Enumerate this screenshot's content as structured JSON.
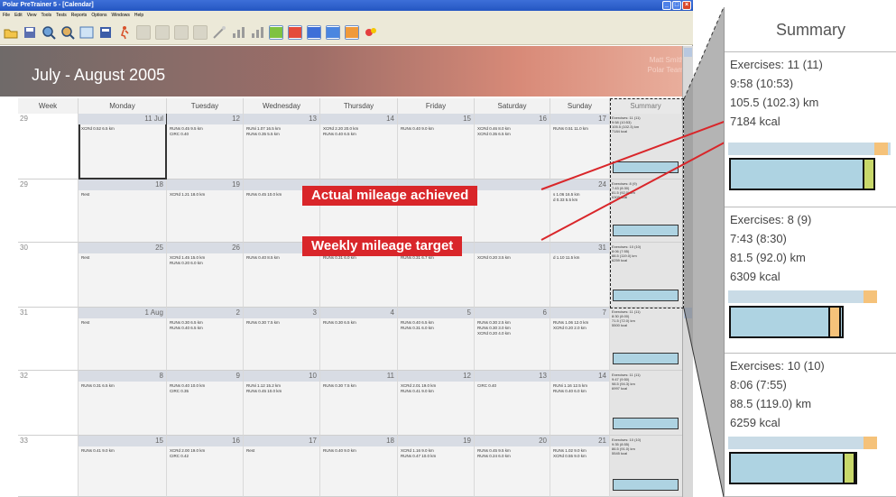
{
  "window": {
    "title": "Polar PreTrainer 5 - [Calendar]"
  },
  "menu": [
    "File",
    "Edit",
    "View",
    "Tools",
    "Tests",
    "Reports",
    "Options",
    "Windows",
    "Help"
  ],
  "toolbar_icons": [
    "open-icon",
    "save-icon",
    "search-icon",
    "search-alt-icon",
    "calendar-icon",
    "notes-icon",
    "runner-icon",
    "graph-dim-1",
    "graph-dim-2",
    "graph-dim-3",
    "graph-dim-4",
    "wand-icon",
    "chart-1",
    "chart-2",
    "chart-3",
    "chart-4",
    "chart-5",
    "chart-6",
    "test-icon"
  ],
  "banner": {
    "title": "July - August 2005",
    "user_name": "Matt Smith",
    "team": "Polar Team"
  },
  "columns": [
    "Week",
    "Monday",
    "Tuesday",
    "Wednesday",
    "Thursday",
    "Friday",
    "Saturday",
    "Sunday",
    "Summary"
  ],
  "weeks": [
    {
      "week": "29",
      "days": [
        {
          "num": "11 Jul",
          "ex": [
            "XCRd 0.52 6.5 km"
          ]
        },
        {
          "num": "12",
          "ex": [
            "RUNs 0.45 9.5 km",
            "CIRC 0.40"
          ]
        },
        {
          "num": "13",
          "ex": [
            "RUNi 1.07 16.5 km",
            "RUNs 0.35 5.5 km"
          ]
        },
        {
          "num": "14",
          "ex": [
            "XCRd 2.20 20.0 km",
            "RUNs 0.40 6.5 km"
          ]
        },
        {
          "num": "15",
          "ex": [
            "RUNs 0.40 9.0 km"
          ]
        },
        {
          "num": "16",
          "ex": [
            "XCRd 0.46 8.0 km",
            "XCRd 0.35 6.5 km"
          ]
        },
        {
          "num": "17",
          "ex": [
            "RUNs 0.51 11.0 km"
          ]
        }
      ],
      "summary": [
        "Exercises: 11 (11)",
        "9:58 (10:53)",
        "105.5 (102.3) km",
        "7184 kcal"
      ]
    },
    {
      "week": "29",
      "days": [
        {
          "num": "18",
          "ex": [
            "Rest"
          ]
        },
        {
          "num": "19",
          "ex": [
            "XCRd 1.21 18.0 km"
          ]
        },
        {
          "num": "",
          "ex": [
            "RUNs 0.45 10.0 km"
          ]
        },
        {
          "num": "",
          "ex": [
            ""
          ]
        },
        {
          "num": "",
          "ex": [
            ""
          ]
        },
        {
          "num": "",
          "ex": [
            ""
          ]
        },
        {
          "num": "24",
          "ex": [
            "s 1.06 16.5 km",
            "d 0.33 5.5 km"
          ]
        }
      ],
      "summary": [
        "Exercises: 8 (9)",
        "7:43 (8:30)",
        "81.5 (92.0) km",
        "6309 kcal"
      ]
    },
    {
      "week": "30",
      "days": [
        {
          "num": "25",
          "ex": [
            "Rest"
          ]
        },
        {
          "num": "26",
          "ex": [
            "XCRd 1.45 15.0 km",
            "RUNs 0.20 6.0 km"
          ]
        },
        {
          "num": "",
          "ex": [
            "RUNs 0.40 8.5 km"
          ]
        },
        {
          "num": "",
          "ex": [
            "RUNs 0.31 6.0 km"
          ]
        },
        {
          "num": "",
          "ex": [
            "RUNs 0.31 6.7 km"
          ]
        },
        {
          "num": "",
          "ex": [
            "XCRd 0.20 3.5 km"
          ]
        },
        {
          "num": "31",
          "ex": [
            "d 1.10 11.5 km"
          ]
        }
      ],
      "summary": [
        "Exercises: 10 (10)",
        "8:06 (7:55)",
        "88.5 (119.0) km",
        "6259 kcal"
      ]
    },
    {
      "week": "31",
      "days": [
        {
          "num": "1 Aug",
          "ex": [
            "Rest"
          ]
        },
        {
          "num": "2",
          "ex": [
            "RUNs 0.30 6.5 km",
            "RUNs 0.40 6.5 km"
          ]
        },
        {
          "num": "3",
          "ex": [
            "RUNs 0.30 7.5 km"
          ]
        },
        {
          "num": "4",
          "ex": [
            "RUNs 0.30 6.5 km"
          ]
        },
        {
          "num": "5",
          "ex": [
            "RUNs 0.40 6.5 km",
            "RUNs 0.31 6.0 km"
          ]
        },
        {
          "num": "6",
          "ex": [
            "RUNs 0.30 2.5 km",
            "RUNs 0.30 3.0 km",
            "XCRd 0.20 4.0 km"
          ]
        },
        {
          "num": "7",
          "ex": [
            "RUNs 1.06 12.0 km",
            "XCRd 0.20 2.0 km"
          ]
        }
      ],
      "summary": [
        "Exercises: 11 (11)",
        "8:30 (8:00)",
        "71.5 (72.0) km",
        "5500 kcal"
      ]
    },
    {
      "week": "32",
      "days": [
        {
          "num": "8",
          "ex": [
            "RUNs 0.31 6.5 km"
          ]
        },
        {
          "num": "9",
          "ex": [
            "RUNs 0.40 10.0 km",
            "CIRC 0.35"
          ]
        },
        {
          "num": "10",
          "ex": [
            "RUNi 1.12 15.2 km",
            "RUNs 0.45 10.0 km"
          ]
        },
        {
          "num": "11",
          "ex": [
            "RUNs 0.30 7.5 km"
          ]
        },
        {
          "num": "12",
          "ex": [
            "XCRd 2.01 19.0 km",
            "RUNs 0.41 9.0 km"
          ]
        },
        {
          "num": "13",
          "ex": [
            "CIRC 0.40"
          ]
        },
        {
          "num": "14",
          "ex": [
            "RUNi 1.16 12.5 km",
            "RUNs 0.40 6.0 km"
          ]
        }
      ],
      "summary": [
        "Exercises: 11 (11)",
        "9:47 (9:50)",
        "98.5 (94.3) km",
        "6997 kcal"
      ]
    },
    {
      "week": "33",
      "days": [
        {
          "num": "15",
          "ex": [
            "RUNs 0.41 9.0 km"
          ]
        },
        {
          "num": "16",
          "ex": [
            "XCRd 2.00 19.0 km",
            "CIRC 0.42"
          ]
        },
        {
          "num": "17",
          "ex": [
            "Rest"
          ]
        },
        {
          "num": "18",
          "ex": [
            "RUNs 0.40 9.0 km"
          ]
        },
        {
          "num": "19",
          "ex": [
            "XCRd 1.16 9.0 km",
            "RUNs 0.47 10.0 km"
          ]
        },
        {
          "num": "20",
          "ex": [
            "RUNs 0.45 9.5 km",
            "RUNs 0.24 6.0 km"
          ]
        },
        {
          "num": "21",
          "ex": [
            "RUNs 1.02 9.0 km",
            "XCRd 0.55 9.0 km"
          ]
        }
      ],
      "summary": [
        "Exercises: 10 (10)",
        "9:35 (8:55)",
        "86.5 (91.0) km",
        "5545 kcal"
      ]
    }
  ],
  "callouts": {
    "actual": "Actual mileage achieved",
    "target": "Weekly mileage target"
  },
  "zoom": {
    "title": "Summary",
    "sections": [
      {
        "lines": [
          "Exercises: 11 (11)",
          "9:58 (10:53)",
          "105.5 (102.3) km",
          "7184 kcal"
        ]
      },
      {
        "lines": [
          "Exercises: 8 (9)",
          "7:43 (8:30)",
          "81.5 (92.0) km",
          "6309 kcal"
        ]
      },
      {
        "lines": [
          "Exercises: 10 (10)",
          "8:06 (7:55)",
          "88.5 (119.0) km",
          "6259 kcal"
        ]
      }
    ]
  },
  "colors": {
    "callout": "#d9262a",
    "bar_fill": "#aed3e2",
    "target_hatch": "#c9dbe6",
    "orange": "#f5c27a",
    "green": "#c8d86a"
  }
}
